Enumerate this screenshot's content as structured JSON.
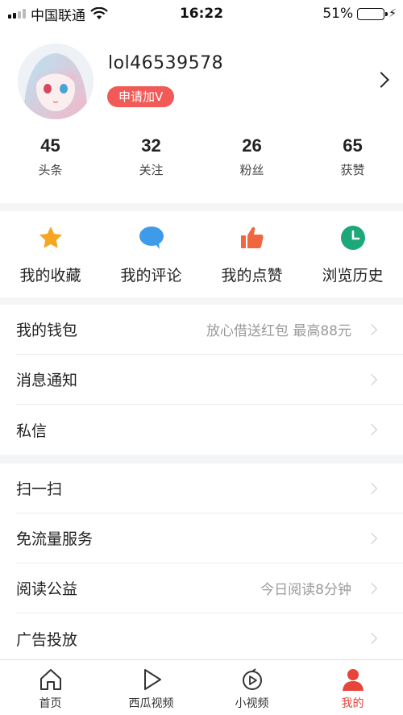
{
  "status_bar": {
    "carrier": "中国联通",
    "time": "16:22",
    "battery_percent": "51%",
    "battery_level": 0.51
  },
  "profile": {
    "username": "lol46539578",
    "verify_label": "申请加V"
  },
  "stats": [
    {
      "value": "45",
      "label": "头条"
    },
    {
      "value": "32",
      "label": "关注"
    },
    {
      "value": "26",
      "label": "粉丝"
    },
    {
      "value": "65",
      "label": "获赞"
    }
  ],
  "actions": [
    {
      "label": "我的收藏",
      "icon": "star-icon",
      "color": "#f5a623"
    },
    {
      "label": "我的评论",
      "icon": "comment-icon",
      "color": "#3d9be9"
    },
    {
      "label": "我的点赞",
      "icon": "thumbs-up-icon",
      "color": "#f0663f"
    },
    {
      "label": "浏览历史",
      "icon": "clock-icon",
      "color": "#1da87a"
    }
  ],
  "menu_group1": [
    {
      "title": "我的钱包",
      "value": "放心借送红包 最高88元"
    },
    {
      "title": "消息通知",
      "value": ""
    },
    {
      "title": "私信",
      "value": ""
    }
  ],
  "menu_group2": [
    {
      "title": "扫一扫",
      "value": ""
    },
    {
      "title": "免流量服务",
      "value": ""
    },
    {
      "title": "阅读公益",
      "value": "今日阅读8分钟"
    },
    {
      "title": "广告投放",
      "value": ""
    }
  ],
  "tabs": [
    {
      "label": "首页",
      "icon": "home-icon",
      "active": false
    },
    {
      "label": "西瓜视频",
      "icon": "play-icon",
      "active": false
    },
    {
      "label": "小视频",
      "icon": "short-video-icon",
      "active": false
    },
    {
      "label": "我的",
      "icon": "person-icon",
      "active": true
    }
  ],
  "colors": {
    "accent": "#e7443a",
    "badge": "#f15a56"
  }
}
